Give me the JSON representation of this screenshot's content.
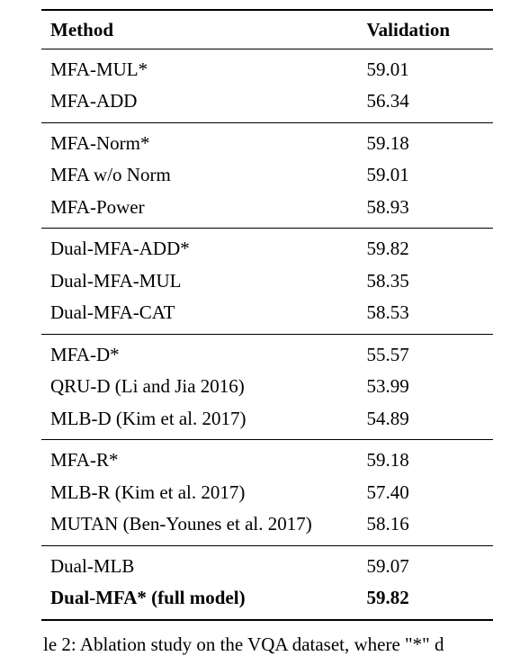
{
  "chart_data": {
    "type": "table",
    "title": "Ablation study on the VQA dataset",
    "columns": [
      "Method",
      "Validation"
    ],
    "groups": [
      [
        {
          "method": "MFA-MUL*",
          "validation": 59.01
        },
        {
          "method": "MFA-ADD",
          "validation": 56.34
        }
      ],
      [
        {
          "method": "MFA-Norm*",
          "validation": 59.18
        },
        {
          "method": "MFA w/o Norm",
          "validation": 59.01
        },
        {
          "method": "MFA-Power",
          "validation": 58.93
        }
      ],
      [
        {
          "method": "Dual-MFA-ADD*",
          "validation": 59.82
        },
        {
          "method": "Dual-MFA-MUL",
          "validation": 58.35
        },
        {
          "method": "Dual-MFA-CAT",
          "validation": 58.53
        }
      ],
      [
        {
          "method": "MFA-D*",
          "validation": 55.57
        },
        {
          "method": "QRU-D (Li and Jia 2016)",
          "validation": 53.99
        },
        {
          "method": "MLB-D (Kim et al. 2017)",
          "validation": 54.89
        }
      ],
      [
        {
          "method": "MFA-R*",
          "validation": 59.18
        },
        {
          "method": "MLB-R (Kim et al. 2017)",
          "validation": 57.4
        },
        {
          "method": "MUTAN (Ben-Younes et al. 2017)",
          "validation": 58.16
        }
      ],
      [
        {
          "method": "Dual-MLB",
          "validation": 59.07
        },
        {
          "method": "Dual-MFA* (full model)",
          "validation": 59.82,
          "bold": true
        }
      ]
    ]
  },
  "header": {
    "method": "Method",
    "validation": "Validation"
  },
  "rows": {
    "g0r0m": "MFA-MUL*",
    "g0r0v": "59.01",
    "g0r1m": "MFA-ADD",
    "g0r1v": "56.34",
    "g1r0m": "MFA-Norm*",
    "g1r0v": "59.18",
    "g1r1m": "MFA w/o Norm",
    "g1r1v": "59.01",
    "g1r2m": "MFA-Power",
    "g1r2v": "58.93",
    "g2r0m": "Dual-MFA-ADD*",
    "g2r0v": "59.82",
    "g2r1m": "Dual-MFA-MUL",
    "g2r1v": "58.35",
    "g2r2m": "Dual-MFA-CAT",
    "g2r2v": "58.53",
    "g3r0m": "MFA-D*",
    "g3r0v": "55.57",
    "g3r1m": "QRU-D (Li and Jia 2016)",
    "g3r1v": "53.99",
    "g3r2m": "MLB-D (Kim et al. 2017)",
    "g3r2v": "54.89",
    "g4r0m": "MFA-R*",
    "g4r0v": "59.18",
    "g4r1m": "MLB-R (Kim et al. 2017)",
    "g4r1v": "57.40",
    "g4r2m": "MUTAN (Ben-Younes et al. 2017)",
    "g4r2v": "58.16",
    "g5r0m": "Dual-MLB",
    "g5r0v": "59.07",
    "g5r1m": "Dual-MFA* (full model)",
    "g5r1v": "59.82"
  },
  "caption": "le 2: Ablation study on the VQA dataset, where \"*\" d"
}
